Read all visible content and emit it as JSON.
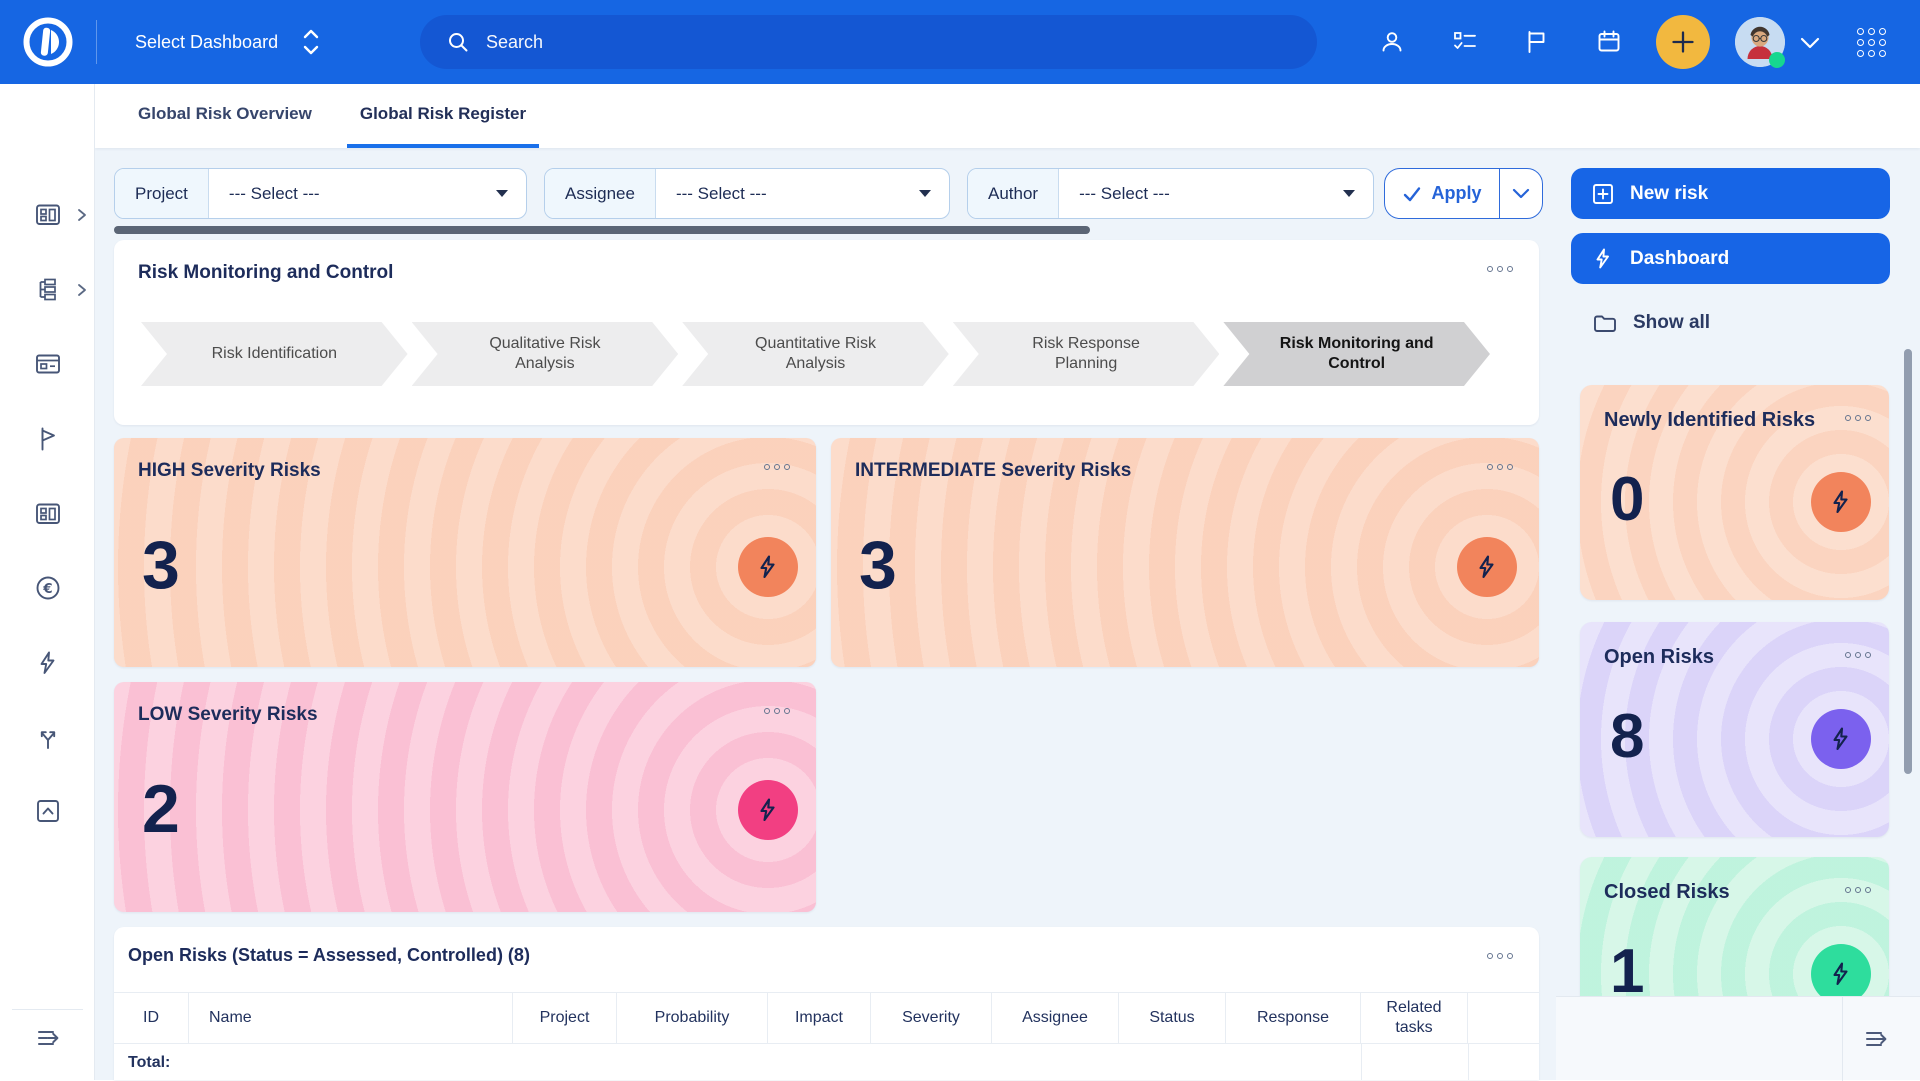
{
  "topbar": {
    "dashboard_selector": "Select Dashboard",
    "search_placeholder": "Search",
    "icons": [
      "user-icon",
      "tasks-icon",
      "flag-icon",
      "calendar-icon",
      "add-button",
      "avatar",
      "chevron-down-icon",
      "apps-grid-icon"
    ]
  },
  "sidebar_icons": [
    "board-icon",
    "tree-icon",
    "window-icon",
    "pennant-icon",
    "board-icon",
    "euro-icon",
    "bolt-icon",
    "split-icon",
    "box-chevron-up-icon",
    "expand-icon"
  ],
  "tabs": [
    {
      "label": "Global Risk Overview",
      "active": false
    },
    {
      "label": "Global Risk Register",
      "active": true
    }
  ],
  "filters": [
    {
      "label": "Project",
      "value": "--- Select ---"
    },
    {
      "label": "Assignee",
      "value": "--- Select ---"
    },
    {
      "label": "Author",
      "value": "--- Select ---"
    }
  ],
  "apply_button": {
    "label": "Apply"
  },
  "process_card": {
    "title": "Risk Monitoring and Control",
    "steps": [
      {
        "label": "Risk Identification",
        "active": false
      },
      {
        "label": "Qualitative Risk Analysis",
        "active": false
      },
      {
        "label": "Quantitative Risk Analysis",
        "active": false
      },
      {
        "label": "Risk Response Planning",
        "active": false
      },
      {
        "label": "Risk Monitoring and Control",
        "active": true
      }
    ]
  },
  "severity_cards": [
    {
      "title": "HIGH Severity Risks",
      "value": "3",
      "theme": "orange"
    },
    {
      "title": "INTERMEDIATE Severity Risks",
      "value": "3",
      "theme": "orange"
    },
    {
      "title": "LOW Severity Risks",
      "value": "2",
      "theme": "pink"
    }
  ],
  "table_card": {
    "title": "Open Risks (Status = Assessed, Controlled) (8)",
    "columns": [
      "ID",
      "Name",
      "Project",
      "Probability",
      "Impact",
      "Severity",
      "Assignee",
      "Status",
      "Response",
      "Related tasks"
    ],
    "total_label": "Total:"
  },
  "right_panel": {
    "new_risk_button": "New risk",
    "dashboard_button": "Dashboard",
    "show_all_link": "Show all",
    "stat_cards": [
      {
        "title": "Newly Identified Risks",
        "value": "0",
        "theme": "orange"
      },
      {
        "title": "Open Risks",
        "value": "8",
        "theme": "purple"
      },
      {
        "title": "Closed Risks",
        "value": "1",
        "theme": "green"
      }
    ]
  },
  "colors": {
    "topbar_blue": "#1666e3",
    "search_pill_blue": "#1457d3",
    "accent_blue": "#1765e6",
    "add_button_yellow": "#f2b83f",
    "navy_text": "#1d2c5b",
    "number_navy": "#13224e",
    "orange_card": "#fcdccb",
    "orange_circle": "#f2845c",
    "pink_card": "#fcd2e0",
    "pink_circle": "#f23f82",
    "purple_card": "#e8e4fb",
    "purple_circle": "#7b61ee",
    "green_card": "#d7f7e8",
    "green_circle": "#2edd9d",
    "online_green": "#16d78f"
  }
}
